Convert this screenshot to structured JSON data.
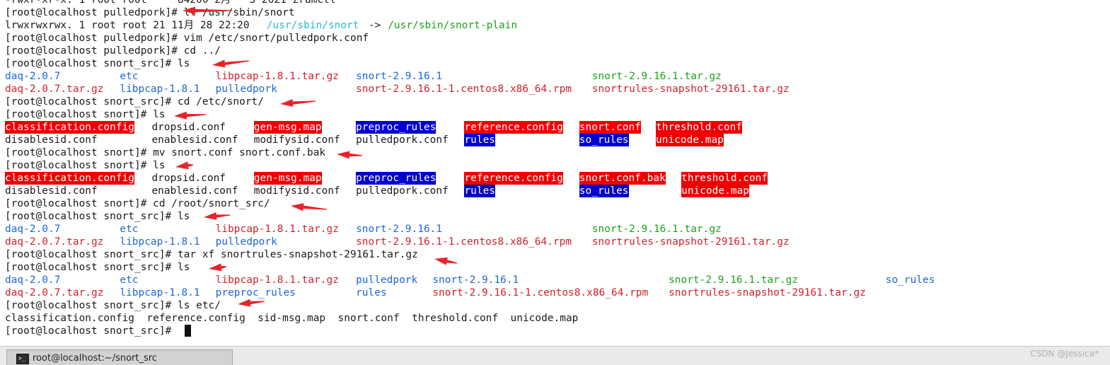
{
  "terminal": {
    "lines": [
      [
        {
          "text": "-rwxr-xr-x. 1 root root     84200 2月   3 2021 zramctl",
          "cls": "c-def",
          "col": 0
        }
      ],
      [
        {
          "text": "[root@localhost pulledpork]# ll /usr/sbin/snort",
          "cls": "c-def",
          "col": 0
        }
      ],
      [
        {
          "text": "lrwxrwxrwx. 1 root root 21 11月 28 22:20 ",
          "cls": "c-def",
          "col": 0
        },
        {
          "text": "/usr/sbin/snort",
          "cls": "c-cyan",
          "col": 41
        },
        {
          "text": " -> ",
          "cls": "c-def",
          "col": 56
        },
        {
          "text": "/usr/sbin/snort-plain",
          "cls": "c-green",
          "col": 60
        }
      ],
      [
        {
          "text": "[root@localhost pulledpork]# vim /etc/snort/pulledpork.conf",
          "cls": "c-def",
          "col": 0
        }
      ],
      [
        {
          "text": "[root@localhost pulledpork]# cd ../",
          "cls": "c-def",
          "col": 0
        }
      ],
      [
        {
          "text": "[root@localhost snort_src]# ls",
          "cls": "c-def",
          "col": 0
        }
      ],
      [
        {
          "text": "daq-2.0.7",
          "cls": "c-blue",
          "col": 0
        },
        {
          "text": "etc",
          "cls": "c-blue",
          "col": 18
        },
        {
          "text": "libpcap-1.8.1.tar.gz",
          "cls": "c-red",
          "col": 33
        },
        {
          "text": "snort-2.9.16.1",
          "cls": "c-blue",
          "col": 55
        },
        {
          "text": "snort-2.9.16.1.tar.gz",
          "cls": "c-green",
          "col": 92
        }
      ],
      [
        {
          "text": "daq-2.0.7.tar.gz",
          "cls": "c-red",
          "col": 0
        },
        {
          "text": "libpcap-1.8.1",
          "cls": "c-blue",
          "col": 18
        },
        {
          "text": "pulledpork",
          "cls": "c-blue",
          "col": 33
        },
        {
          "text": "snort-2.9.16.1-1.centos8.x86_64.rpm",
          "cls": "c-red",
          "col": 55
        },
        {
          "text": "snortrules-snapshot-29161.tar.gz",
          "cls": "c-red",
          "col": 92
        }
      ],
      [
        {
          "text": "[root@localhost snort_src]# cd /etc/snort/",
          "cls": "c-def",
          "col": 0
        }
      ],
      [
        {
          "text": "[root@localhost snort]# ls",
          "cls": "c-def",
          "col": 0
        }
      ],
      [
        {
          "text": "classification.config",
          "cls": "hl-red",
          "col": 0
        },
        {
          "text": "dropsid.conf",
          "cls": "c-def",
          "col": 23
        },
        {
          "text": "gen-msg.map",
          "cls": "hl-red",
          "col": 39
        },
        {
          "text": "preproc_rules",
          "cls": "hl-blue",
          "col": 55
        },
        {
          "text": "reference.config",
          "cls": "hl-red",
          "col": 72
        },
        {
          "text": "snort.conf",
          "cls": "hl-red",
          "col": 90
        },
        {
          "text": "threshold.conf",
          "cls": "hl-red",
          "col": 102
        }
      ],
      [
        {
          "text": "disablesid.conf",
          "cls": "c-def",
          "col": 0
        },
        {
          "text": "enablesid.conf",
          "cls": "c-def",
          "col": 23
        },
        {
          "text": "modifysid.conf",
          "cls": "c-def",
          "col": 39
        },
        {
          "text": "pulledpork.conf",
          "cls": "c-def",
          "col": 55
        },
        {
          "text": "rules",
          "cls": "hl-blue",
          "col": 72
        },
        {
          "text": "so_rules",
          "cls": "hl-blue",
          "col": 90
        },
        {
          "text": "unicode.map",
          "cls": "hl-red",
          "col": 102
        }
      ],
      [
        {
          "text": "[root@localhost snort]# mv snort.conf snort.conf.bak",
          "cls": "c-def",
          "col": 0
        }
      ],
      [
        {
          "text": "[root@localhost snort]# ls",
          "cls": "c-def",
          "col": 0
        }
      ],
      [
        {
          "text": "classification.config",
          "cls": "hl-red",
          "col": 0
        },
        {
          "text": "dropsid.conf",
          "cls": "c-def",
          "col": 23
        },
        {
          "text": "gen-msg.map",
          "cls": "hl-red",
          "col": 39
        },
        {
          "text": "preproc_rules",
          "cls": "hl-blue",
          "col": 55
        },
        {
          "text": "reference.config",
          "cls": "hl-red",
          "col": 72
        },
        {
          "text": "snort.conf.bak",
          "cls": "hl-red",
          "col": 90
        },
        {
          "text": "threshold.conf",
          "cls": "hl-red",
          "col": 106
        }
      ],
      [
        {
          "text": "disablesid.conf",
          "cls": "c-def",
          "col": 0
        },
        {
          "text": "enablesid.conf",
          "cls": "c-def",
          "col": 23
        },
        {
          "text": "modifysid.conf",
          "cls": "c-def",
          "col": 39
        },
        {
          "text": "pulledpork.conf",
          "cls": "c-def",
          "col": 55
        },
        {
          "text": "rules",
          "cls": "hl-blue",
          "col": 72
        },
        {
          "text": "so_rules",
          "cls": "hl-blue",
          "col": 90
        },
        {
          "text": "unicode.map",
          "cls": "hl-red",
          "col": 106
        }
      ],
      [
        {
          "text": "[root@localhost snort]# cd /root/snort_src/",
          "cls": "c-def",
          "col": 0
        }
      ],
      [
        {
          "text": "[root@localhost snort_src]# ls",
          "cls": "c-def",
          "col": 0
        }
      ],
      [
        {
          "text": "daq-2.0.7",
          "cls": "c-blue",
          "col": 0
        },
        {
          "text": "etc",
          "cls": "c-blue",
          "col": 18
        },
        {
          "text": "libpcap-1.8.1.tar.gz",
          "cls": "c-red",
          "col": 33
        },
        {
          "text": "snort-2.9.16.1",
          "cls": "c-blue",
          "col": 55
        },
        {
          "text": "snort-2.9.16.1.tar.gz",
          "cls": "c-green",
          "col": 92
        }
      ],
      [
        {
          "text": "daq-2.0.7.tar.gz",
          "cls": "c-red",
          "col": 0
        },
        {
          "text": "libpcap-1.8.1",
          "cls": "c-blue",
          "col": 18
        },
        {
          "text": "pulledpork",
          "cls": "c-blue",
          "col": 33
        },
        {
          "text": "snort-2.9.16.1-1.centos8.x86_64.rpm",
          "cls": "c-red",
          "col": 55
        },
        {
          "text": "snortrules-snapshot-29161.tar.gz",
          "cls": "c-red",
          "col": 92
        }
      ],
      [
        {
          "text": "[root@localhost snort_src]# tar xf snortrules-snapshot-29161.tar.gz",
          "cls": "c-def",
          "col": 0
        }
      ],
      [
        {
          "text": "[root@localhost snort_src]# ls",
          "cls": "c-def",
          "col": 0
        }
      ],
      [
        {
          "text": "daq-2.0.7",
          "cls": "c-blue",
          "col": 0
        },
        {
          "text": "etc",
          "cls": "c-blue",
          "col": 18
        },
        {
          "text": "libpcap-1.8.1.tar.gz",
          "cls": "c-red",
          "col": 33
        },
        {
          "text": "pulledpork",
          "cls": "c-blue",
          "col": 55
        },
        {
          "text": "snort-2.9.16.1",
          "cls": "c-blue",
          "col": 67
        },
        {
          "text": "snort-2.9.16.1.tar.gz",
          "cls": "c-green",
          "col": 104
        },
        {
          "text": "so_rules",
          "cls": "c-blue",
          "col": 138
        }
      ],
      [
        {
          "text": "daq-2.0.7.tar.gz",
          "cls": "c-red",
          "col": 0
        },
        {
          "text": "libpcap-1.8.1",
          "cls": "c-blue",
          "col": 18
        },
        {
          "text": "preproc_rules",
          "cls": "c-blue",
          "col": 33
        },
        {
          "text": "rules",
          "cls": "c-blue",
          "col": 55
        },
        {
          "text": "snort-2.9.16.1-1.centos8.x86_64.rpm",
          "cls": "c-red",
          "col": 67
        },
        {
          "text": "snortrules-snapshot-29161.tar.gz",
          "cls": "c-red",
          "col": 104
        }
      ],
      [
        {
          "text": "[root@localhost snort_src]# ls etc/",
          "cls": "c-def",
          "col": 0
        }
      ],
      [
        {
          "text": "classification.config  reference.config  sid-msg.map  snort.conf  threshold.conf  unicode.map",
          "cls": "c-def",
          "col": 0
        }
      ],
      [
        {
          "text": "[root@localhost snort_src]# ",
          "cls": "c-def",
          "col": 0
        }
      ]
    ],
    "cursor_line": 26,
    "cursor_col": 28
  },
  "annotations": {
    "arrow_color": "#e8232a",
    "arrow_count": 14
  },
  "taskbar": {
    "window_label": "root@localhost:~/snort_src",
    "icon_glyph": ">_"
  },
  "watermark": "CSDN @Jessica*"
}
